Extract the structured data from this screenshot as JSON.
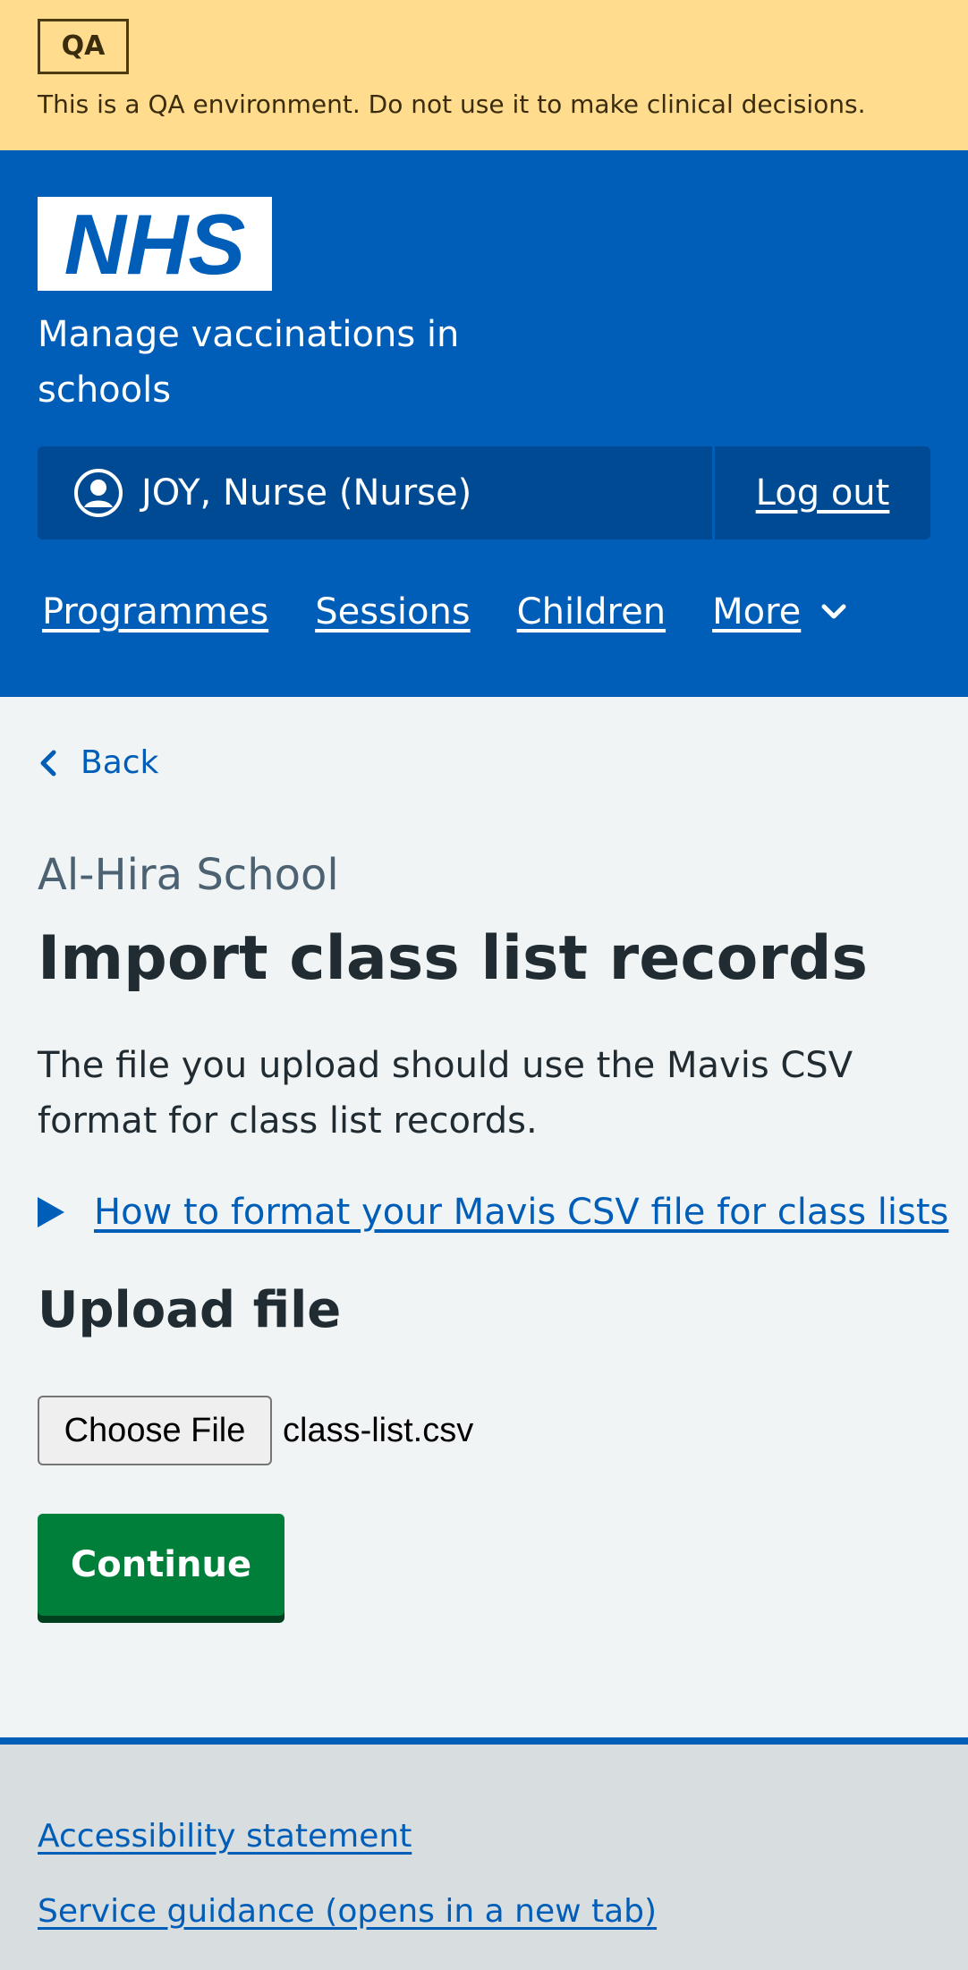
{
  "qa_banner": {
    "tag": "QA",
    "message": "This is a QA environment. Do not use it to make clinical decisions.",
    "background_color": "#ffdc8e"
  },
  "header": {
    "logo_text": "NHS",
    "service_name": "Manage vaccinations in schools",
    "background_color": "#005eb8",
    "account": {
      "user_icon": "user-circle-icon",
      "user_label": "JOY, Nurse (Nurse)",
      "logout_label": "Log out"
    },
    "nav": {
      "items": [
        {
          "label": "Programmes"
        },
        {
          "label": "Sessions"
        },
        {
          "label": "Children"
        }
      ],
      "more_label": "More",
      "more_icon": "chevron-down-icon"
    }
  },
  "main": {
    "back_label": "Back",
    "caption": "Al-Hira School",
    "title": "Import class list records",
    "lead": "The file you upload should use the Mavis CSV format for class list records.",
    "details_summary": "How to format your Mavis CSV file for class lists",
    "upload_heading": "Upload file",
    "choose_file_label": "Choose File",
    "file_name": "class-list.csv",
    "continue_label": "Continue",
    "continue_color": "#007f3b"
  },
  "footer": {
    "links": [
      {
        "label": "Accessibility statement"
      },
      {
        "label": "Service guidance (opens in a new tab)"
      }
    ]
  }
}
